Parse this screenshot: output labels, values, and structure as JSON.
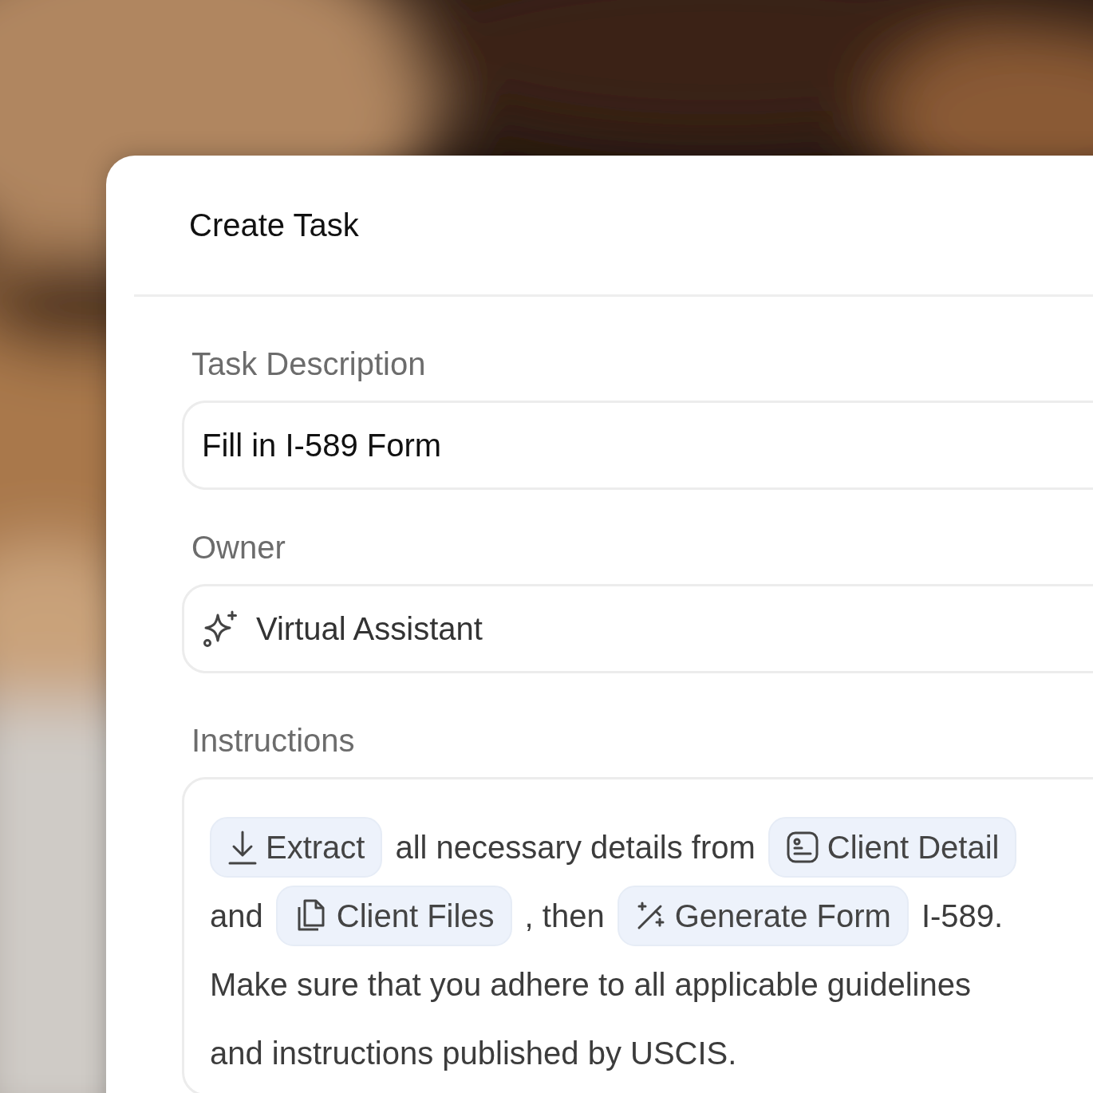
{
  "dialog": {
    "title": "Create Task"
  },
  "fields": [
    {
      "label": "Task Description",
      "kind": "text",
      "value": "Fill in I-589 Form"
    },
    {
      "label": "Owner",
      "kind": "owner",
      "value": "Virtual Assistant"
    }
  ],
  "instructions": {
    "label": "Instructions",
    "lines": [
      [
        {
          "kind": "chip",
          "text": "Extract"
        },
        {
          "kind": "text",
          "text": "all necessary details from"
        },
        {
          "kind": "chip",
          "text": "Client Detail"
        }
      ],
      [
        {
          "kind": "text",
          "text": "and"
        },
        {
          "kind": "chip",
          "text": "Client Files"
        },
        {
          "kind": "text",
          "text": ", then"
        },
        {
          "kind": "chip",
          "text": "Generate Form"
        },
        {
          "kind": "text",
          "text": "I-589."
        }
      ],
      [
        {
          "kind": "text",
          "text": "Make sure that you adhere to all applicable guidelines"
        }
      ],
      [
        {
          "kind": "text",
          "text": "and instructions published by USCIS."
        }
      ]
    ]
  }
}
